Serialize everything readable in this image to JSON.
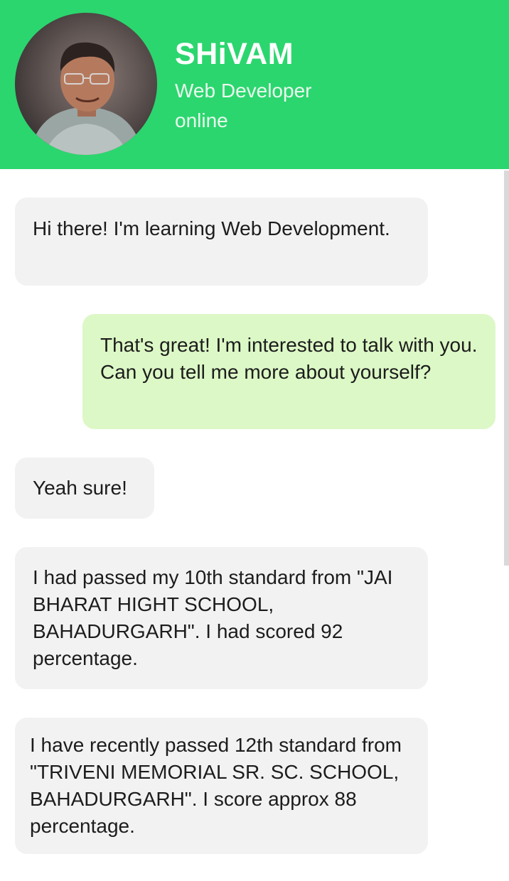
{
  "header": {
    "name": "SHiVAM",
    "role": "Web Developer",
    "status": "online",
    "background_color": "#2bd66e"
  },
  "messages": [
    {
      "direction": "received",
      "text": "Hi there! I'm learning Web Development."
    },
    {
      "direction": "sent",
      "text": "That's great! I'm interested to talk with you. Can you tell me more about yourself?"
    },
    {
      "direction": "received",
      "text": "Yeah sure!"
    },
    {
      "direction": "received",
      "text": "I had passed my 10th standard from \"JAI BHARAT HIGHT SCHOOL, BAHADURGARH\". I had scored 92 percentage."
    },
    {
      "direction": "received",
      "text": "I have recently passed 12th standard from \"TRIVENI MEMORIAL SR. SC. SCHOOL, BAHADURGARH\". I score approx 88 percentage."
    }
  ],
  "colors": {
    "received_bubble": "#f2f2f2",
    "sent_bubble": "#dcf8c6"
  }
}
